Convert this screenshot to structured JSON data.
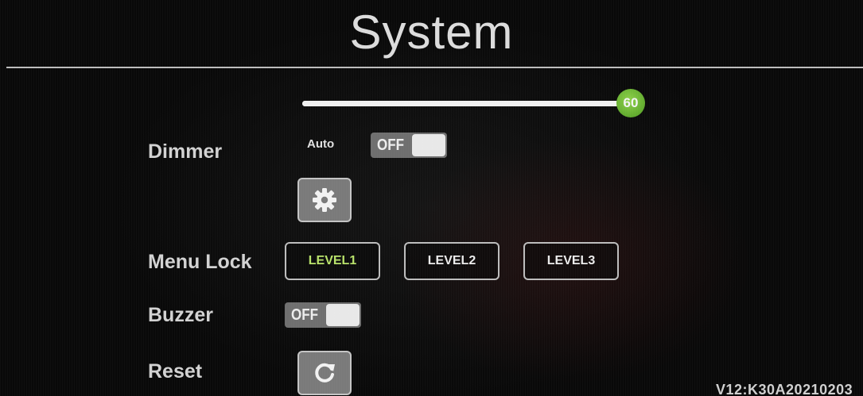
{
  "header": {
    "title": "System"
  },
  "dimmer": {
    "label": "Dimmer",
    "slider_value": 60,
    "slider_value_text": "60",
    "slider_fraction": 0.96,
    "auto_label": "Auto",
    "auto_toggle_text": "OFF",
    "settings_icon": "gear-icon"
  },
  "menu_lock": {
    "label": "Menu Lock",
    "levels": [
      "LEVEL1",
      "LEVEL2",
      "LEVEL3"
    ],
    "selected": "LEVEL1"
  },
  "buzzer": {
    "label": "Buzzer",
    "toggle_text": "OFF"
  },
  "reset": {
    "label": "Reset",
    "icon": "refresh-icon"
  },
  "footer": {
    "version": "V12:K30A20210203"
  },
  "colors": {
    "accent_green": "#8ed14a",
    "active_level_text": "#b8e26a",
    "toggle_off": "#6f6f6f"
  }
}
